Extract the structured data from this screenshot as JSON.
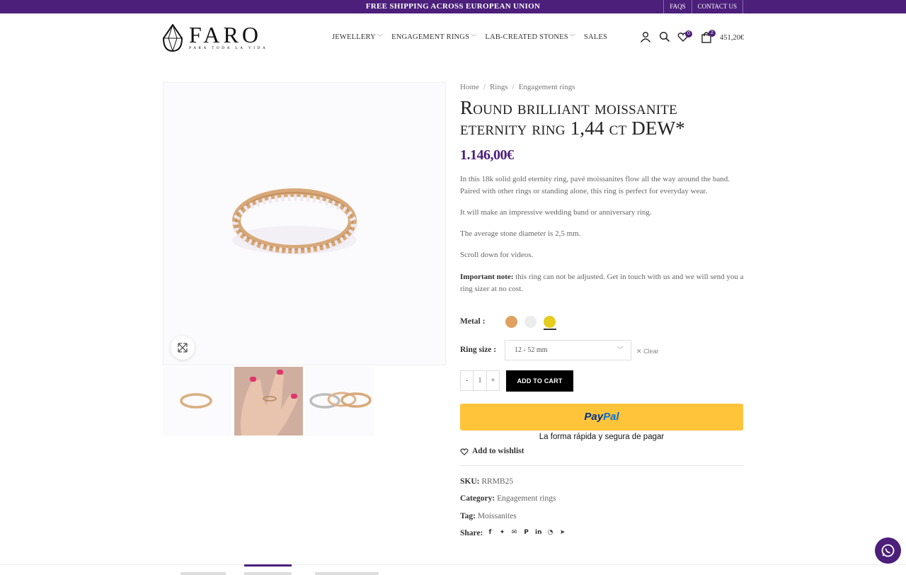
{
  "topbar": {
    "shipping": "FREE SHIPPING ACROSS EUROPEAN UNION",
    "faqs": "FAQS",
    "contact": "CONTACT US"
  },
  "brand": {
    "name": "FARO",
    "tagline": "PARA TODA LA VIDA"
  },
  "nav": [
    {
      "label": "JEWELLERY",
      "dropdown": true
    },
    {
      "label": "ENGAGEMENT RINGS",
      "dropdown": true
    },
    {
      "label": "LAB-CREATED STONES",
      "dropdown": true
    },
    {
      "label": "SALES",
      "dropdown": false
    }
  ],
  "header": {
    "wishlist_count": "0",
    "cart_count": "2",
    "cart_total": "451,20€"
  },
  "breadcrumb": {
    "home": "Home",
    "rings": "Rings",
    "engagement": "Engagement rings"
  },
  "product": {
    "title": "Round brilliant moissanite eternity ring 1,44 ct DEW*",
    "price": "1.146,00€",
    "desc1": "In this 18k solid gold eternity ring, pavé moissanites flow all the way around the band. Paired with other rings or standing alone, this ring is perfect for everyday wear.",
    "desc2": "It will make an impressive wedding band or anniversary ring.",
    "desc3": "The average stone diameter is 2,5 mm.",
    "desc4": "Scroll down for videos.",
    "note_label": "Important note:",
    "note_text": " this ring can not be adjusted. Get in touch with us and we will send you a ring sizer at no cost.",
    "metal_label": "Metal",
    "metals": [
      {
        "name": "rose gold",
        "color": "#e0a060"
      },
      {
        "name": "white gold",
        "color": "#ececec"
      },
      {
        "name": "yellow gold",
        "color": "#e6cc1c",
        "selected": true
      }
    ],
    "ring_size_label": "Ring size",
    "ring_size_value": "12 - 52 mm",
    "clear_label": "Clear",
    "quantity": "1",
    "minus": "-",
    "plus": "+",
    "add_to_cart": "ADD TO CART",
    "paypal_pay": "Pay",
    "paypal_pal": "Pal",
    "paypal_sub": "La forma rápida y segura de pagar",
    "wishlist": "Add to wishlist",
    "sku_label": "SKU:",
    "sku": "RRMB25",
    "category_label": "Category:",
    "category": "Engagement rings",
    "tag_label": "Tag:",
    "tag": "Moissanites",
    "share_label": "Share:",
    "share_icons": [
      "facebook-icon",
      "twitter-icon",
      "email-icon",
      "pinterest-icon",
      "linkedin-icon",
      "whatsapp-icon",
      "telegram-icon"
    ]
  },
  "colors": {
    "brand": "#4b1f7a",
    "paypal": "#ffc43a"
  }
}
